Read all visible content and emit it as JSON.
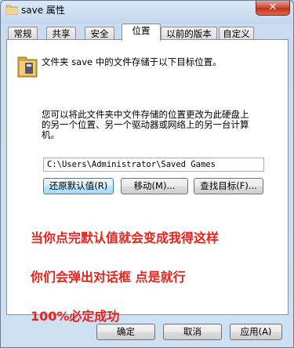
{
  "window": {
    "title": "save 属性",
    "close_label": "✕"
  },
  "tabs": [
    {
      "label": "常规"
    },
    {
      "label": "共享"
    },
    {
      "label": "安全"
    },
    {
      "label": "位置"
    },
    {
      "label": "以前的版本"
    },
    {
      "label": "自定义"
    }
  ],
  "location": {
    "intro": "文件夹 save 中的文件存储于以下目标位置。",
    "description": "您可以将此文件夹中文件存储的位置更改为此硬盘上的另一个位置、另一个驱动器或网络上的另一台计算机。",
    "path": "C:\\Users\\Administrator\\Saved Games",
    "restore_default_label": "还原默认值(R)",
    "move_label": "移动(M)...",
    "find_target_label": "查找目标(F)..."
  },
  "annotations": [
    "当你点完默认值就会变成我得这样",
    "你们会弹出对话框 点是就行",
    "100%必定成功"
  ],
  "colors": {
    "annotation": "#e8231c",
    "focus_border": "#3c7fb1"
  },
  "footer": {
    "ok_label": "确定",
    "cancel_label": "取消",
    "apply_label": "应用(A)"
  }
}
